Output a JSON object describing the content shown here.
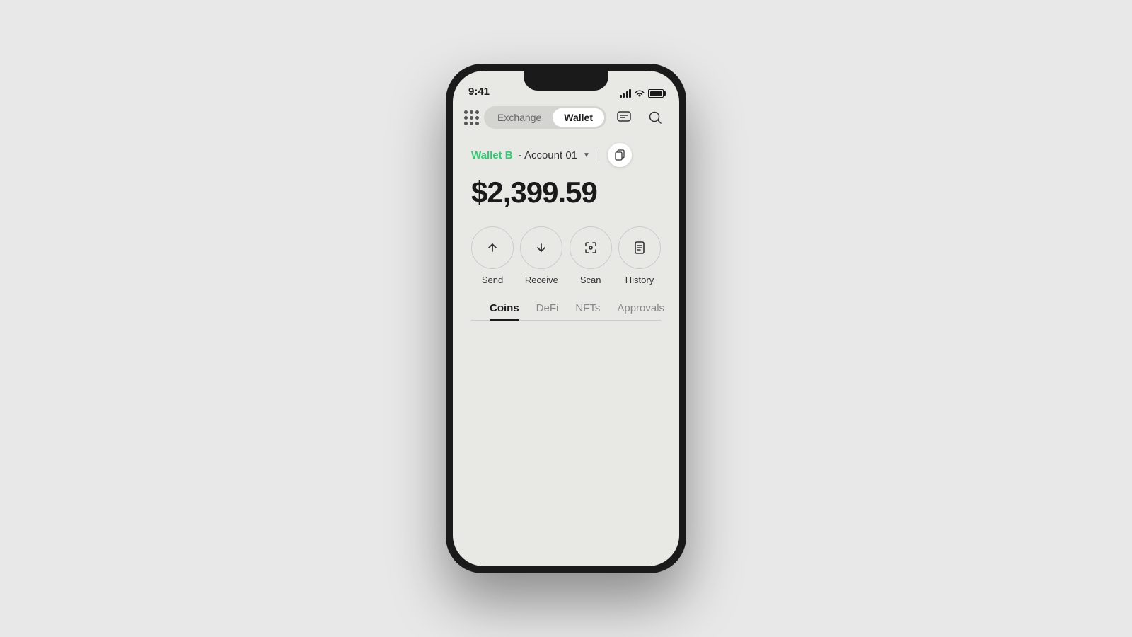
{
  "status": {
    "time": "9:41",
    "battery_full": true
  },
  "header": {
    "exchange_label": "Exchange",
    "wallet_label": "Wallet",
    "active_tab": "wallet"
  },
  "account": {
    "wallet_name": "Wallet B",
    "separator": "-",
    "account_name": "Account 01",
    "balance": "$2,399.59"
  },
  "actions": [
    {
      "id": "send",
      "label": "Send",
      "icon": "arrow-up"
    },
    {
      "id": "receive",
      "label": "Receive",
      "icon": "arrow-down"
    },
    {
      "id": "scan",
      "label": "Scan",
      "icon": "scan"
    },
    {
      "id": "history",
      "label": "History",
      "icon": "history"
    }
  ],
  "tabs": [
    {
      "id": "coins",
      "label": "Coins",
      "active": true
    },
    {
      "id": "defi",
      "label": "DeFi",
      "active": false
    },
    {
      "id": "nfts",
      "label": "NFTs",
      "active": false
    },
    {
      "id": "approvals",
      "label": "Approvals",
      "active": false
    }
  ]
}
